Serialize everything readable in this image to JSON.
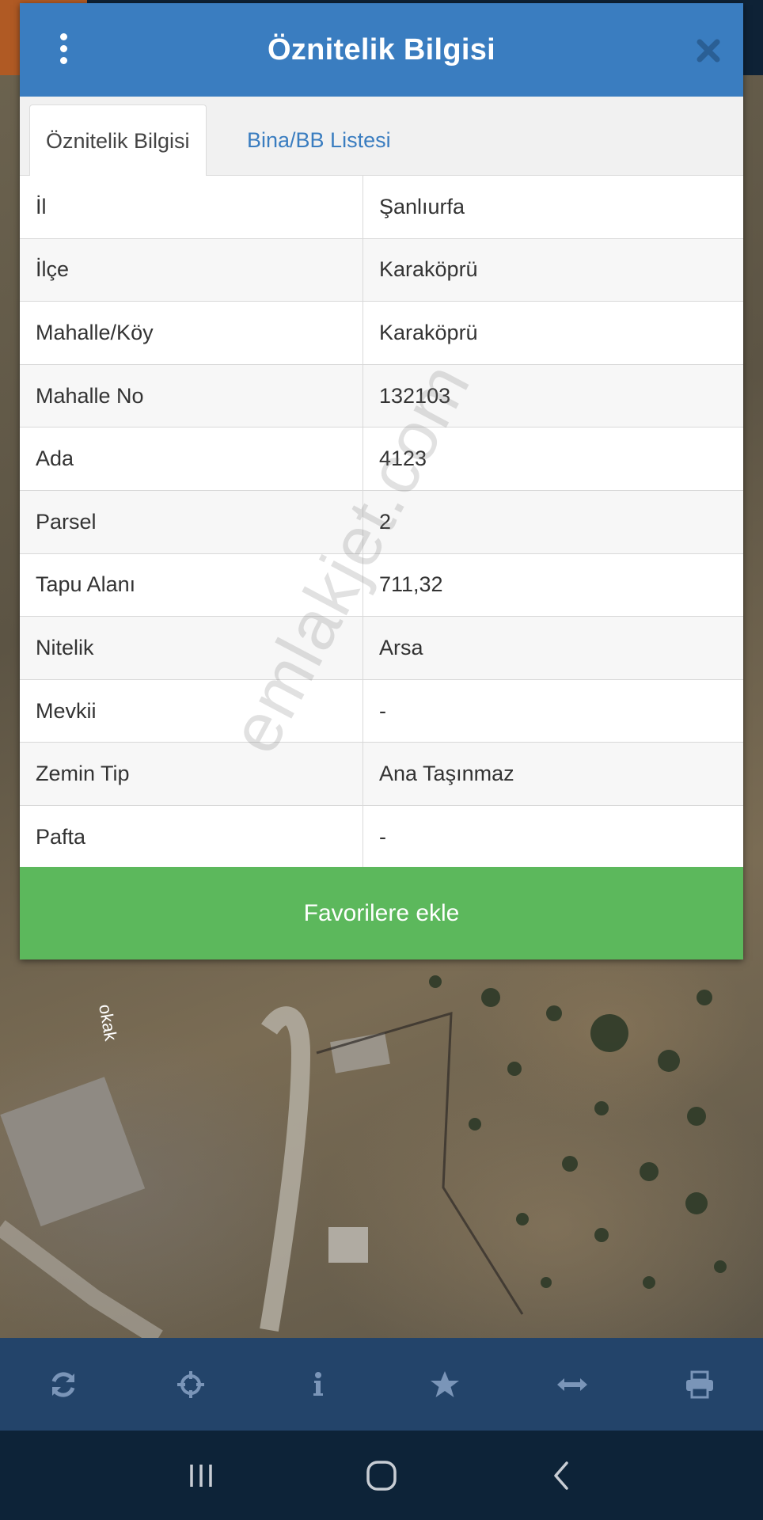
{
  "dialog": {
    "title": "Öznitelik Bilgisi",
    "menu_icon": "kebab-menu-icon",
    "close_icon": "close-icon",
    "tabs": [
      {
        "label": "Öznitelik Bilgisi",
        "active": true
      },
      {
        "label": "Bina/BB Listesi",
        "active": false
      }
    ],
    "rows": [
      {
        "label": "İl",
        "value": "Şanlıurfa"
      },
      {
        "label": "İlçe",
        "value": "Karaköprü"
      },
      {
        "label": "Mahalle/Köy",
        "value": "Karaköprü"
      },
      {
        "label": "Mahalle No",
        "value": "132103"
      },
      {
        "label": "Ada",
        "value": "4123"
      },
      {
        "label": "Parsel",
        "value": "2"
      },
      {
        "label": "Tapu Alanı",
        "value": "711,32"
      },
      {
        "label": "Nitelik",
        "value": "Arsa"
      },
      {
        "label": "Mevkii",
        "value": "-"
      },
      {
        "label": "Zemin Tip",
        "value": "Ana Taşınmaz"
      },
      {
        "label": "Pafta",
        "value": "-"
      }
    ],
    "favorite_button": "Favorilere ekle"
  },
  "watermark": "emlakjet.com",
  "map": {
    "street_label": "okak"
  },
  "toolbar": {
    "items": [
      "refresh-icon",
      "locate-icon",
      "info-icon",
      "star-icon",
      "measure-icon",
      "print-icon"
    ]
  },
  "navbar": {
    "items": [
      "recent-apps-icon",
      "home-icon",
      "back-icon"
    ]
  },
  "colors": {
    "header": "#3a7dc0",
    "favorite_button": "#5cb85c",
    "toolbar": "#23446a",
    "navbar": "#0d2338"
  }
}
